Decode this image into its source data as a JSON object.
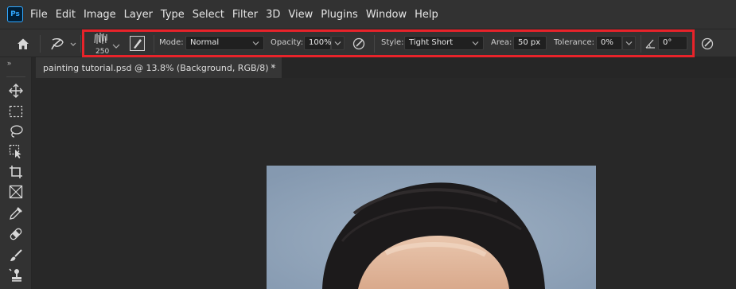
{
  "menubar": {
    "logo_text": "Ps",
    "items": [
      "File",
      "Edit",
      "Image",
      "Layer",
      "Type",
      "Select",
      "Filter",
      "3D",
      "View",
      "Plugins",
      "Window",
      "Help"
    ]
  },
  "options_bar": {
    "brush_size": "250",
    "mode_label": "Mode:",
    "mode_value": "Normal",
    "opacity_label": "Opacity:",
    "opacity_value": "100%",
    "style_label": "Style:",
    "style_value": "Tight Short",
    "area_label": "Area:",
    "area_value": "50 px",
    "tolerance_label": "Tolerance:",
    "tolerance_value": "0%",
    "angle_value": "0°"
  },
  "document": {
    "tab_title": "painting tutorial.psd @ 13.8% (Background, RGB/8) *",
    "close_glyph": "×"
  },
  "toolbar": {
    "collapse_glyph": "»",
    "tools": [
      "move-tool",
      "rectangular-marquee-tool",
      "lasso-tool",
      "object-selection-tool",
      "crop-tool",
      "frame-tool",
      "eyedropper-tool",
      "spot-healing-brush-tool",
      "brush-tool",
      "clone-stamp-tool"
    ]
  },
  "colors": {
    "highlight": "#e8232a",
    "ps_logo_bg": "#001e36",
    "ps_logo_fg": "#31a8ff"
  }
}
